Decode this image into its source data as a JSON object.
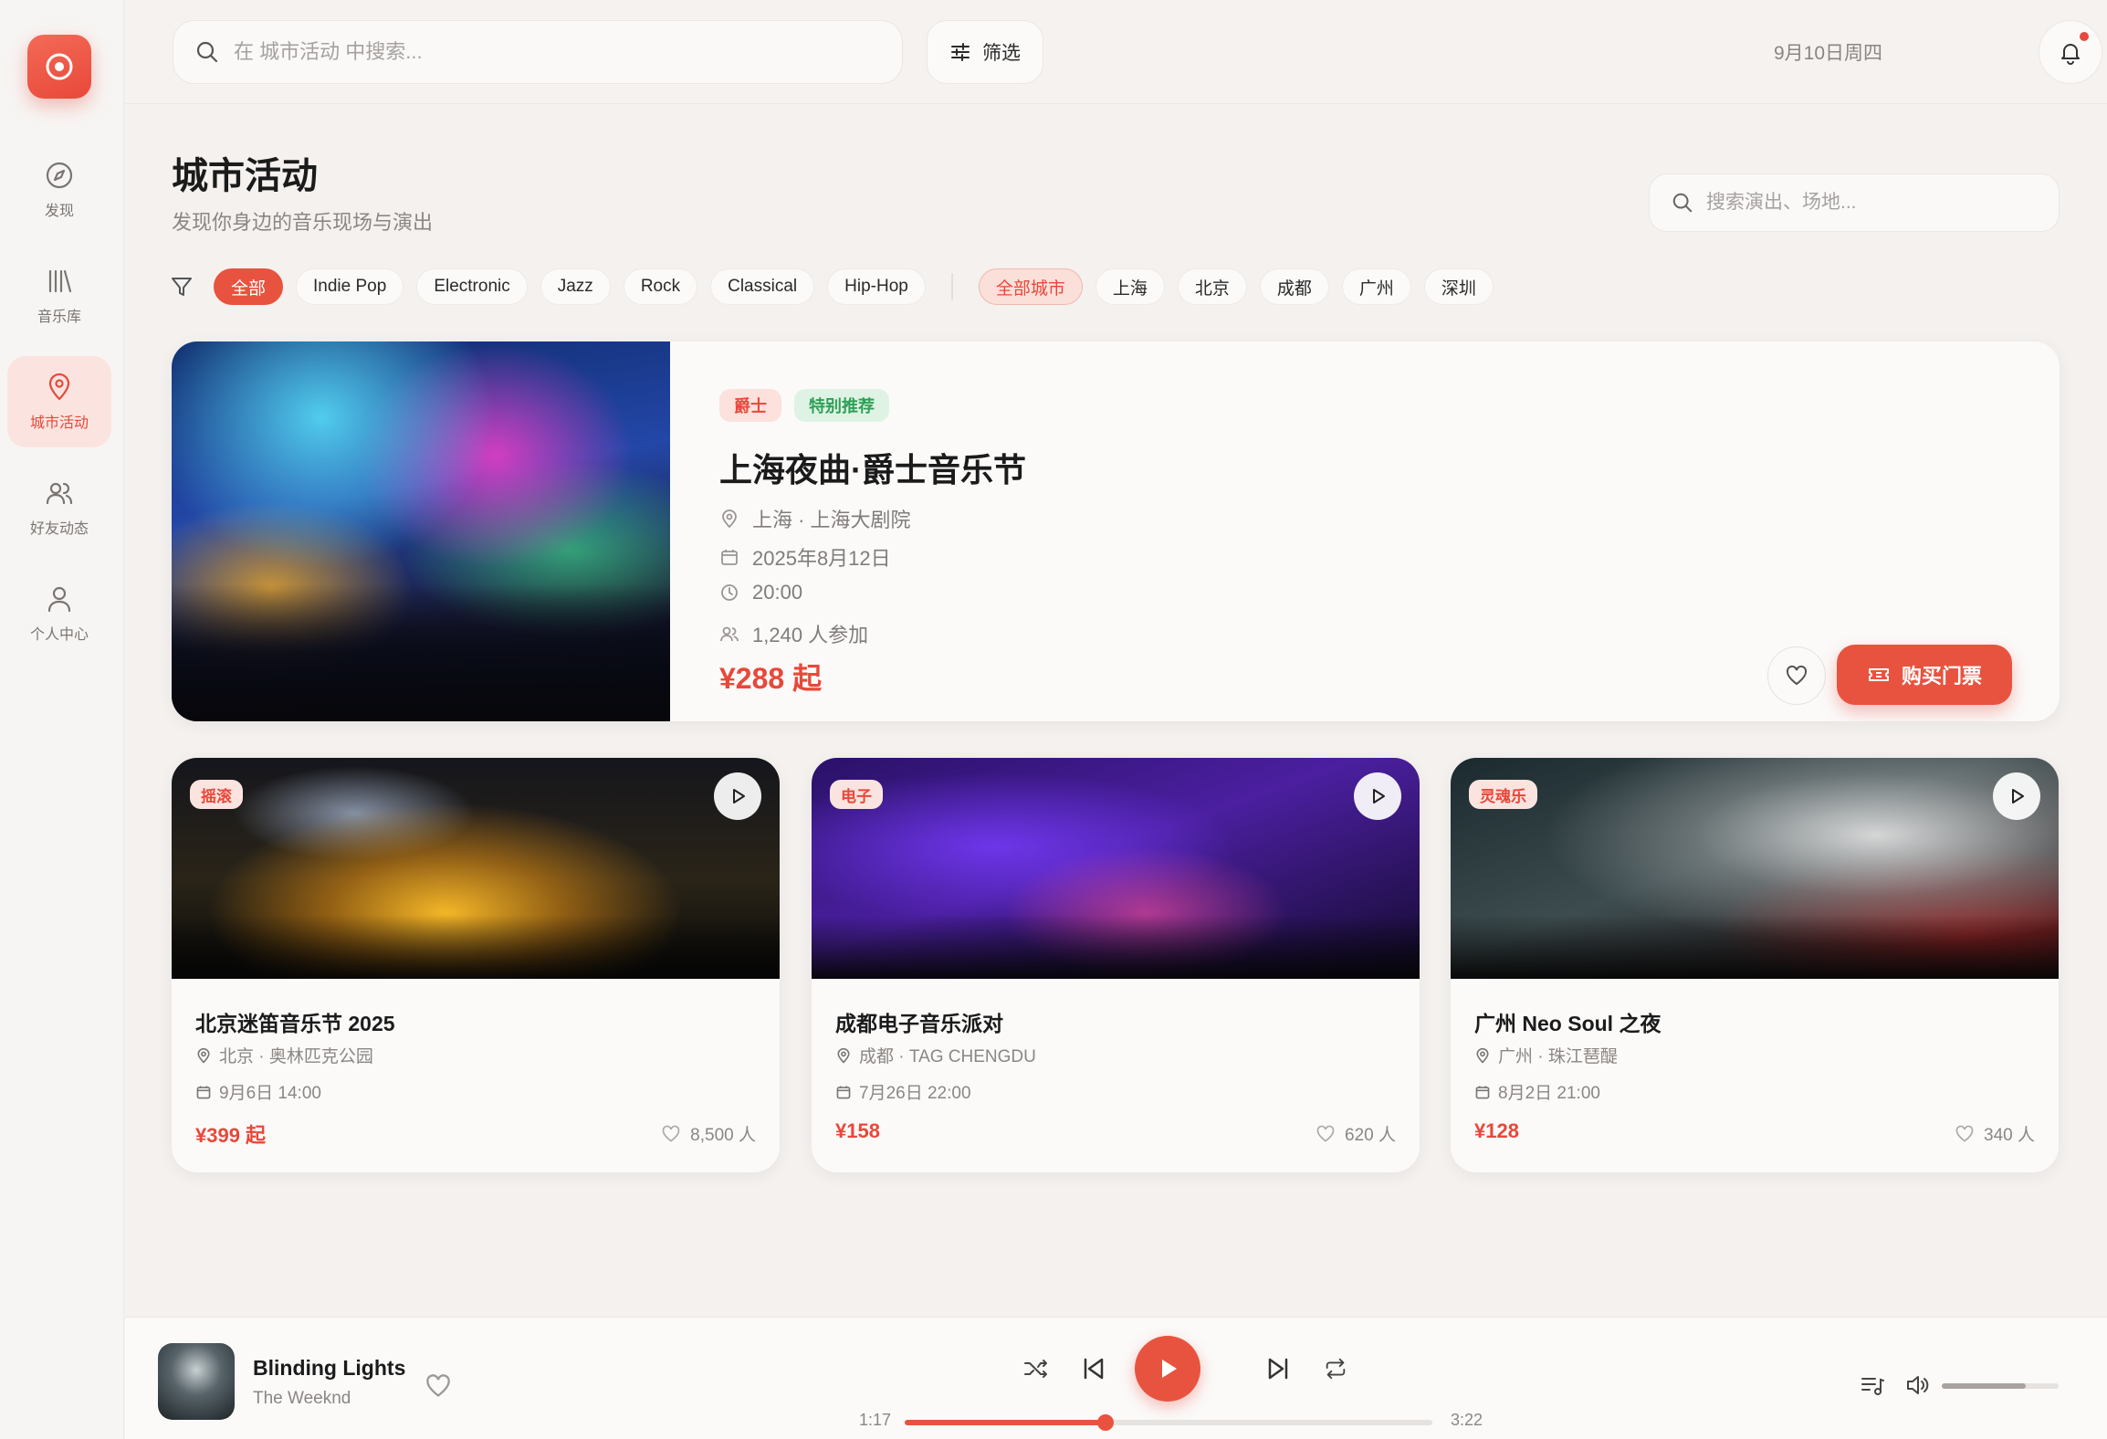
{
  "sidebar": {
    "items": [
      {
        "label": "发现",
        "icon": "compass-icon"
      },
      {
        "label": "音乐库",
        "icon": "library-icon"
      },
      {
        "label": "城市活动",
        "icon": "location-pin-icon",
        "active": true
      },
      {
        "label": "好友动态",
        "icon": "friends-icon"
      },
      {
        "label": "个人中心",
        "icon": "user-icon"
      }
    ]
  },
  "topbar": {
    "search_placeholder": "在 城市活动 中搜索...",
    "filter_label": "筛选",
    "date": "9月10日周四"
  },
  "page": {
    "title": "城市活动",
    "subtitle": "发现你身边的音乐现场与演出",
    "search_placeholder": "搜索演出、场地..."
  },
  "genres": [
    "全部",
    "Indie Pop",
    "Electronic",
    "Jazz",
    "Rock",
    "Classical",
    "Hip-Hop"
  ],
  "cities": [
    "全部城市",
    "上海",
    "北京",
    "成都",
    "广州",
    "深圳"
  ],
  "featured": {
    "tags": [
      "爵士",
      "特别推荐"
    ],
    "title": "上海夜曲·爵士音乐节",
    "location": "上海 · 上海大剧院",
    "date": "2025年8月12日",
    "time": "20:00",
    "attendees": "1,240 人参加",
    "price": "¥288 起",
    "buy_label": "购买门票"
  },
  "events": [
    {
      "tag": "摇滚",
      "title": "北京迷笛音乐节 2025",
      "location": "北京 · 奥林匹克公园",
      "datetime": "9月6日 14:00",
      "price": "¥399 起",
      "count": "8,500 人"
    },
    {
      "tag": "电子",
      "title": "成都电子音乐派对",
      "location": "成都 · TAG CHENGDU",
      "datetime": "7月26日 22:00",
      "price": "¥158",
      "count": "620 人"
    },
    {
      "tag": "灵魂乐",
      "title": "广州 Neo Soul 之夜",
      "location": "广州 · 珠江琶醍",
      "datetime": "8月2日 21:00",
      "price": "¥128",
      "count": "340 人"
    }
  ],
  "player": {
    "title": "Blinding Lights",
    "artist": "The Weeknd",
    "current_time": "1:17",
    "total_time": "3:22",
    "progress": 0.38,
    "volume": 0.72
  },
  "colors": {
    "accent": "#e8533f",
    "background": "#f4f1ef",
    "card": "#fbfaf9"
  }
}
